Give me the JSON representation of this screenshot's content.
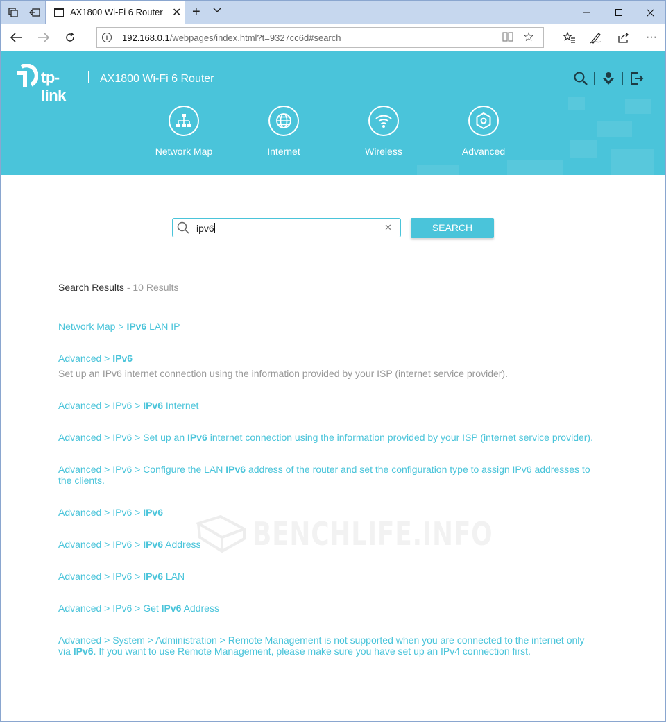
{
  "browser": {
    "tab_title": "AX1800 Wi-Fi 6 Router",
    "url_host": "192.168.0.1",
    "url_path": "/webpages/index.html?t=9327cc6d#search"
  },
  "router": {
    "brand": "tp-link",
    "model": "AX1800 Wi-Fi 6 Router",
    "nav": [
      {
        "label": "Network Map",
        "icon": "network-map-icon"
      },
      {
        "label": "Internet",
        "icon": "globe-icon"
      },
      {
        "label": "Wireless",
        "icon": "wifi-icon"
      },
      {
        "label": "Advanced",
        "icon": "gear-icon"
      }
    ]
  },
  "search": {
    "value": "ipv6",
    "button_label": "SEARCH"
  },
  "results": {
    "heading": "Search Results",
    "count_text": " - 10 Results",
    "items": [
      {
        "parts": [
          {
            "t": "Network Map > "
          },
          {
            "t": "IPv6",
            "b": true
          },
          {
            "t": " LAN IP"
          }
        ],
        "desc": ""
      },
      {
        "parts": [
          {
            "t": "Advanced > "
          },
          {
            "t": "IPv6",
            "b": true
          }
        ],
        "desc": "Set up an IPv6 internet connection using the information provided by your ISP (internet service provider)."
      },
      {
        "parts": [
          {
            "t": "Advanced > IPv6 > "
          },
          {
            "t": "IPv6",
            "b": true
          },
          {
            "t": " Internet"
          }
        ],
        "desc": ""
      },
      {
        "parts": [
          {
            "t": "Advanced > IPv6 > Set up an "
          },
          {
            "t": "IPv6",
            "b": true
          },
          {
            "t": " internet connection using the information provided by your ISP (internet service provider)."
          }
        ],
        "desc": ""
      },
      {
        "parts": [
          {
            "t": "Advanced > IPv6 > Configure the LAN "
          },
          {
            "t": "IPv6",
            "b": true
          },
          {
            "t": " address of the router and set the configuration type to assign IPv6 addresses to the clients."
          }
        ],
        "desc": ""
      },
      {
        "parts": [
          {
            "t": "Advanced > IPv6 > "
          },
          {
            "t": "IPv6",
            "b": true
          }
        ],
        "desc": ""
      },
      {
        "parts": [
          {
            "t": "Advanced > IPv6 > "
          },
          {
            "t": "IPv6",
            "b": true
          },
          {
            "t": " Address"
          }
        ],
        "desc": ""
      },
      {
        "parts": [
          {
            "t": "Advanced > IPv6 > "
          },
          {
            "t": "IPv6",
            "b": true
          },
          {
            "t": " LAN"
          }
        ],
        "desc": ""
      },
      {
        "parts": [
          {
            "t": "Advanced > IPv6 > Get "
          },
          {
            "t": "IPv6",
            "b": true
          },
          {
            "t": " Address"
          }
        ],
        "desc": ""
      },
      {
        "parts": [
          {
            "t": "Advanced > System > Administration > Remote Management is not supported when you are connected to the internet only via "
          },
          {
            "t": "IPv6",
            "b": true
          },
          {
            "t": ". If you want to use Remote Management, please make sure you have set up an IPv4 connection first."
          }
        ],
        "desc": ""
      }
    ]
  },
  "watermark": "BENCHLIFE.INFO",
  "colors": {
    "accent": "#4ac4da",
    "muted_text": "#999999"
  }
}
